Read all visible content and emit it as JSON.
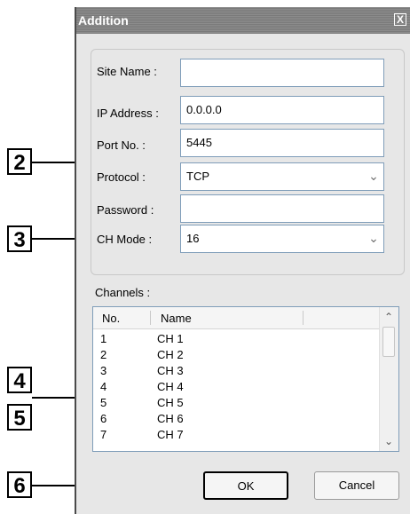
{
  "dialog": {
    "title": "Addition",
    "close_label": "X",
    "fields": {
      "site_name": {
        "label": "Site Name :",
        "value": ""
      },
      "ip_address": {
        "label": "IP Address :",
        "value": "0.0.0.0"
      },
      "port_no": {
        "label": "Port No. :",
        "value": "5445"
      },
      "protocol": {
        "label": "Protocol :",
        "value": "TCP"
      },
      "password": {
        "label": "Password :",
        "value": ""
      },
      "ch_mode": {
        "label": "CH Mode :",
        "value": "16"
      }
    },
    "channels": {
      "label": "Channels :",
      "columns": [
        "No.",
        "Name"
      ],
      "rows": [
        {
          "no": "1",
          "name": "CH 1"
        },
        {
          "no": "2",
          "name": "CH 2"
        },
        {
          "no": "3",
          "name": "CH 3"
        },
        {
          "no": "4",
          "name": "CH 4"
        },
        {
          "no": "5",
          "name": "CH 5"
        },
        {
          "no": "6",
          "name": "CH 6"
        },
        {
          "no": "7",
          "name": "CH 7"
        }
      ]
    },
    "buttons": {
      "ok": "OK",
      "cancel": "Cancel"
    }
  },
  "callouts": [
    "2",
    "3",
    "4",
    "5",
    "6"
  ],
  "icons": {
    "dropdown": "chevron-down-icon",
    "scroll_up": "arrow-up-icon",
    "scroll_down": "arrow-down-icon",
    "close": "close-icon"
  }
}
